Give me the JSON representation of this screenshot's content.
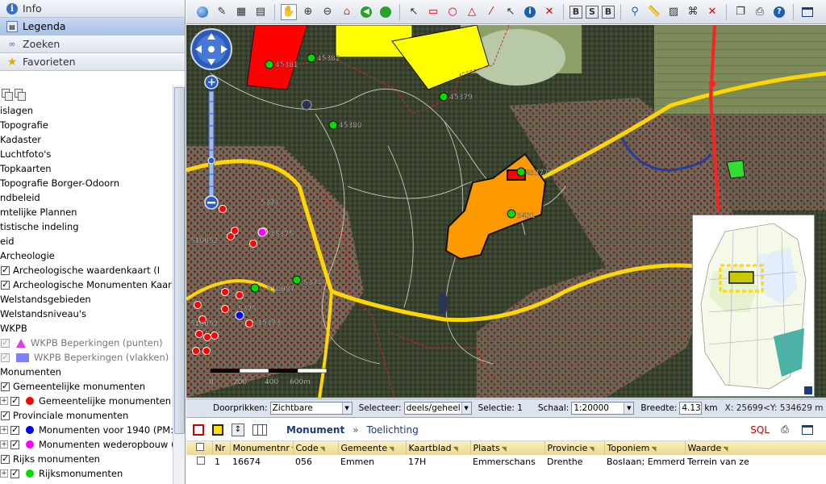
{
  "accordion": [
    {
      "label": "Info",
      "icon": "info-icon",
      "active": false
    },
    {
      "label": "Legenda",
      "icon": "legend-icon",
      "active": true
    },
    {
      "label": "Zoeken",
      "icon": "binoculars-icon",
      "active": false
    },
    {
      "label": "Favorieten",
      "icon": "star-icon",
      "active": false
    }
  ],
  "layers": [
    {
      "label": "islagen"
    },
    {
      "label": "Topografie"
    },
    {
      "label": "Kadaster"
    },
    {
      "label": "Luchtfoto's"
    },
    {
      "label": "Topkaarten"
    },
    {
      "label": "Topografie Borger-Odoorn"
    },
    {
      "label": "ndbeleid"
    },
    {
      "label": "mtelijke Plannen"
    },
    {
      "label": "tistische indeling"
    },
    {
      "label": "eid"
    },
    {
      "label": "Archeologie"
    },
    {
      "label": "Archeologische waardenkaart (I"
    },
    {
      "label": "Archeologische Monumenten Kaar"
    },
    {
      "label": "Welstandsgebieden"
    },
    {
      "label": "Welstandsniveau's"
    },
    {
      "label": "WKPB"
    },
    {
      "label": "WKPB Beperkingen (punten)"
    },
    {
      "label": "WKPB Beperkingen (vlakken)"
    },
    {
      "label": "Monumenten"
    },
    {
      "label": "Gemeentelijke monumenten"
    },
    {
      "label": "Gemeentelijke monumenten"
    },
    {
      "label": "Provinciale monumenten"
    },
    {
      "label": "Monumenten voor 1940 (PM:"
    },
    {
      "label": "Monumenten wederopbouw ("
    },
    {
      "label": "Rijks monumenten"
    },
    {
      "label": "Rijksmonumenten"
    }
  ],
  "colors": {
    "red_dot": "#ff0000",
    "blue_dot": "#0000ff",
    "magenta_dot": "#ff00ff",
    "green_dot": "#00dd00",
    "road": "#ffd700",
    "selection": "#ff9900"
  },
  "map": {
    "scalebar": {
      "labels": [
        "0",
        "200",
        "400",
        "600m"
      ]
    },
    "labels": [
      "45381",
      "45382",
      "45379",
      "45380",
      "5374",
      "45377",
      "5431",
      "5374",
      "510087",
      "45375",
      "510052",
      "510052",
      "5375",
      "45373"
    ]
  },
  "status": {
    "doorprikken_label": "Doorprikken:",
    "doorprikken_value": "Zichtbare",
    "selecteer_label": "Selecteer:",
    "selecteer_value": "deels/geheel",
    "selectie_label": "Selectie: 1",
    "schaal_label": "Schaal:",
    "schaal_value": "1:20000",
    "breedte_label": "Breedte:",
    "breedte_value": "4.13",
    "breedte_unit": "km",
    "coords": "X: 25699<Y: 534629 m"
  },
  "result": {
    "title": "Monument",
    "separator": "»",
    "subtitle": "Toelichting",
    "sql_label": "SQL",
    "columns": [
      "Nr",
      "Monumentnr",
      "Code",
      "Gemeente",
      "Kaartblad",
      "Plaats",
      "Provincie",
      "Toponiem",
      "Waarde"
    ],
    "rows": [
      [
        "1",
        "16674",
        "056",
        "Emmen",
        "17H",
        "Emmerschans",
        "Drenthe",
        "Boslaan; Emmerdennen",
        "Terrein van ze"
      ]
    ]
  }
}
